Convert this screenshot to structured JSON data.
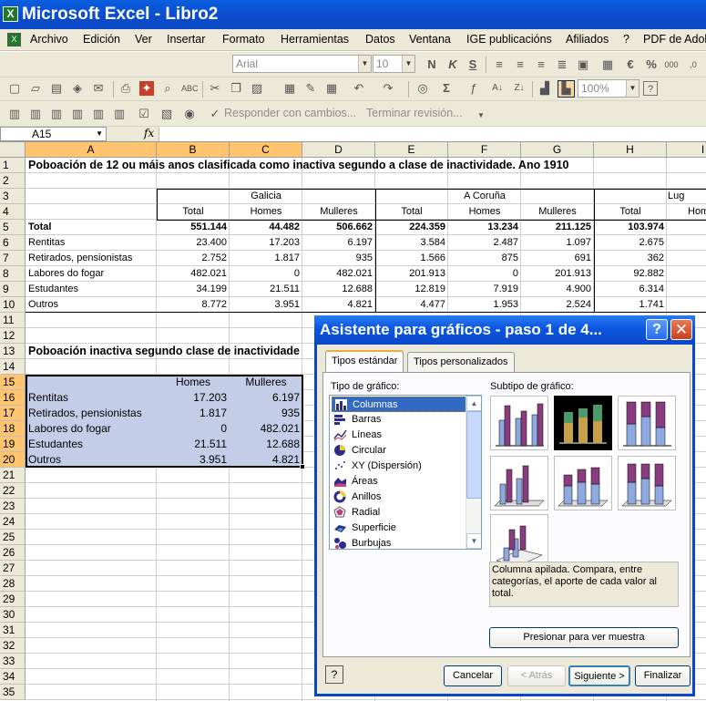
{
  "window": {
    "title": "Microsoft Excel - Libro2"
  },
  "menu": [
    "Archivo",
    "Edición",
    "Ver",
    "Insertar",
    "Formato",
    "Herramientas",
    "Datos",
    "Ventana",
    "IGE publicacións",
    "Afiliados",
    "?",
    "PDF de Adobe"
  ],
  "toolbar": {
    "font": "Arial",
    "size": "10",
    "zoom": "100%",
    "review_reply": "Responder con cambios...",
    "review_end": "Terminar revisión..."
  },
  "formula": {
    "namebox": "A15",
    "fx": "fx",
    "content": ""
  },
  "columns": [
    "A",
    "B",
    "C",
    "D",
    "E",
    "F",
    "G",
    "H",
    "I"
  ],
  "rows": [
    "1",
    "2",
    "3",
    "4",
    "5",
    "6",
    "7",
    "8",
    "9",
    "10",
    "11",
    "12",
    "13",
    "14",
    "15",
    "16",
    "17",
    "18",
    "19",
    "20",
    "21",
    "22",
    "23",
    "24",
    "25",
    "26",
    "27",
    "28",
    "29",
    "30",
    "31",
    "32",
    "33",
    "34",
    "35"
  ],
  "sheet": {
    "title1": "Poboación de 12 ou máis anos clasificada como inactiva segundo a clase de inactividade. Ano 1910",
    "region1": "Galicia",
    "region2": "A Coruña",
    "region3": "Lug",
    "sub_headers": [
      "Total",
      "Homes",
      "Mulleres",
      "Total",
      "Homes",
      "Mulleres",
      "Total",
      "Hom"
    ],
    "table": [
      {
        "label": "Total",
        "values": [
          "551.144",
          "44.482",
          "506.662",
          "224.359",
          "13.234",
          "211.125",
          "103.974"
        ]
      },
      {
        "label": "Rentitas",
        "values": [
          "23.400",
          "17.203",
          "6.197",
          "3.584",
          "2.487",
          "1.097",
          "2.675"
        ]
      },
      {
        "label": "Retirados, pensionistas",
        "values": [
          "2.752",
          "1.817",
          "935",
          "1.566",
          "875",
          "691",
          "362"
        ]
      },
      {
        "label": "Labores do fogar",
        "values": [
          "482.021",
          "0",
          "482.021",
          "201.913",
          "0",
          "201.913",
          "92.882"
        ]
      },
      {
        "label": "Estudantes",
        "values": [
          "34.199",
          "21.511",
          "12.688",
          "12.819",
          "7.919",
          "4.900",
          "6.314"
        ]
      },
      {
        "label": "Outros",
        "values": [
          "8.772",
          "3.951",
          "4.821",
          "4.477",
          "1.953",
          "2.524",
          "1.741"
        ]
      }
    ],
    "title2": "Poboación inactiva segundo clase de inactividade",
    "table2_headers": [
      "Homes",
      "Mulleres"
    ],
    "table2": [
      {
        "label": "Rentitas",
        "values": [
          "17.203",
          "6.197"
        ]
      },
      {
        "label": "Retirados, pensionistas",
        "values": [
          "1.817",
          "935"
        ]
      },
      {
        "label": "Labores do fogar",
        "values": [
          "0",
          "482.021"
        ]
      },
      {
        "label": "Estudantes",
        "values": [
          "21.511",
          "12.688"
        ]
      },
      {
        "label": "Outros",
        "values": [
          "3.951",
          "4.821"
        ]
      }
    ]
  },
  "dialog": {
    "title": "Asistente para gráficos - paso 1 de 4...",
    "tabs": [
      "Tipos estándar",
      "Tipos personalizados"
    ],
    "type_label": "Tipo de gráfico:",
    "subtype_label": "Subtipo de gráfico:",
    "types": [
      "Columnas",
      "Barras",
      "Líneas",
      "Circular",
      "XY (Dispersión)",
      "Áreas",
      "Anillos",
      "Radial",
      "Superficie",
      "Burbujas"
    ],
    "description": "Columna apilada. Compara, entre categorías, el aporte de cada valor al total.",
    "preview_button": "Presionar para ver muestra",
    "buttons": {
      "cancel": "Cancelar",
      "back": "< Atrás",
      "next": "Siguiente >",
      "finish": "Finalizar"
    }
  },
  "colors": {
    "title_bar": "#0b4ed0",
    "selection": "#c3cde8",
    "header_selected": "#ffc56e",
    "list_selected": "#316ac5"
  }
}
